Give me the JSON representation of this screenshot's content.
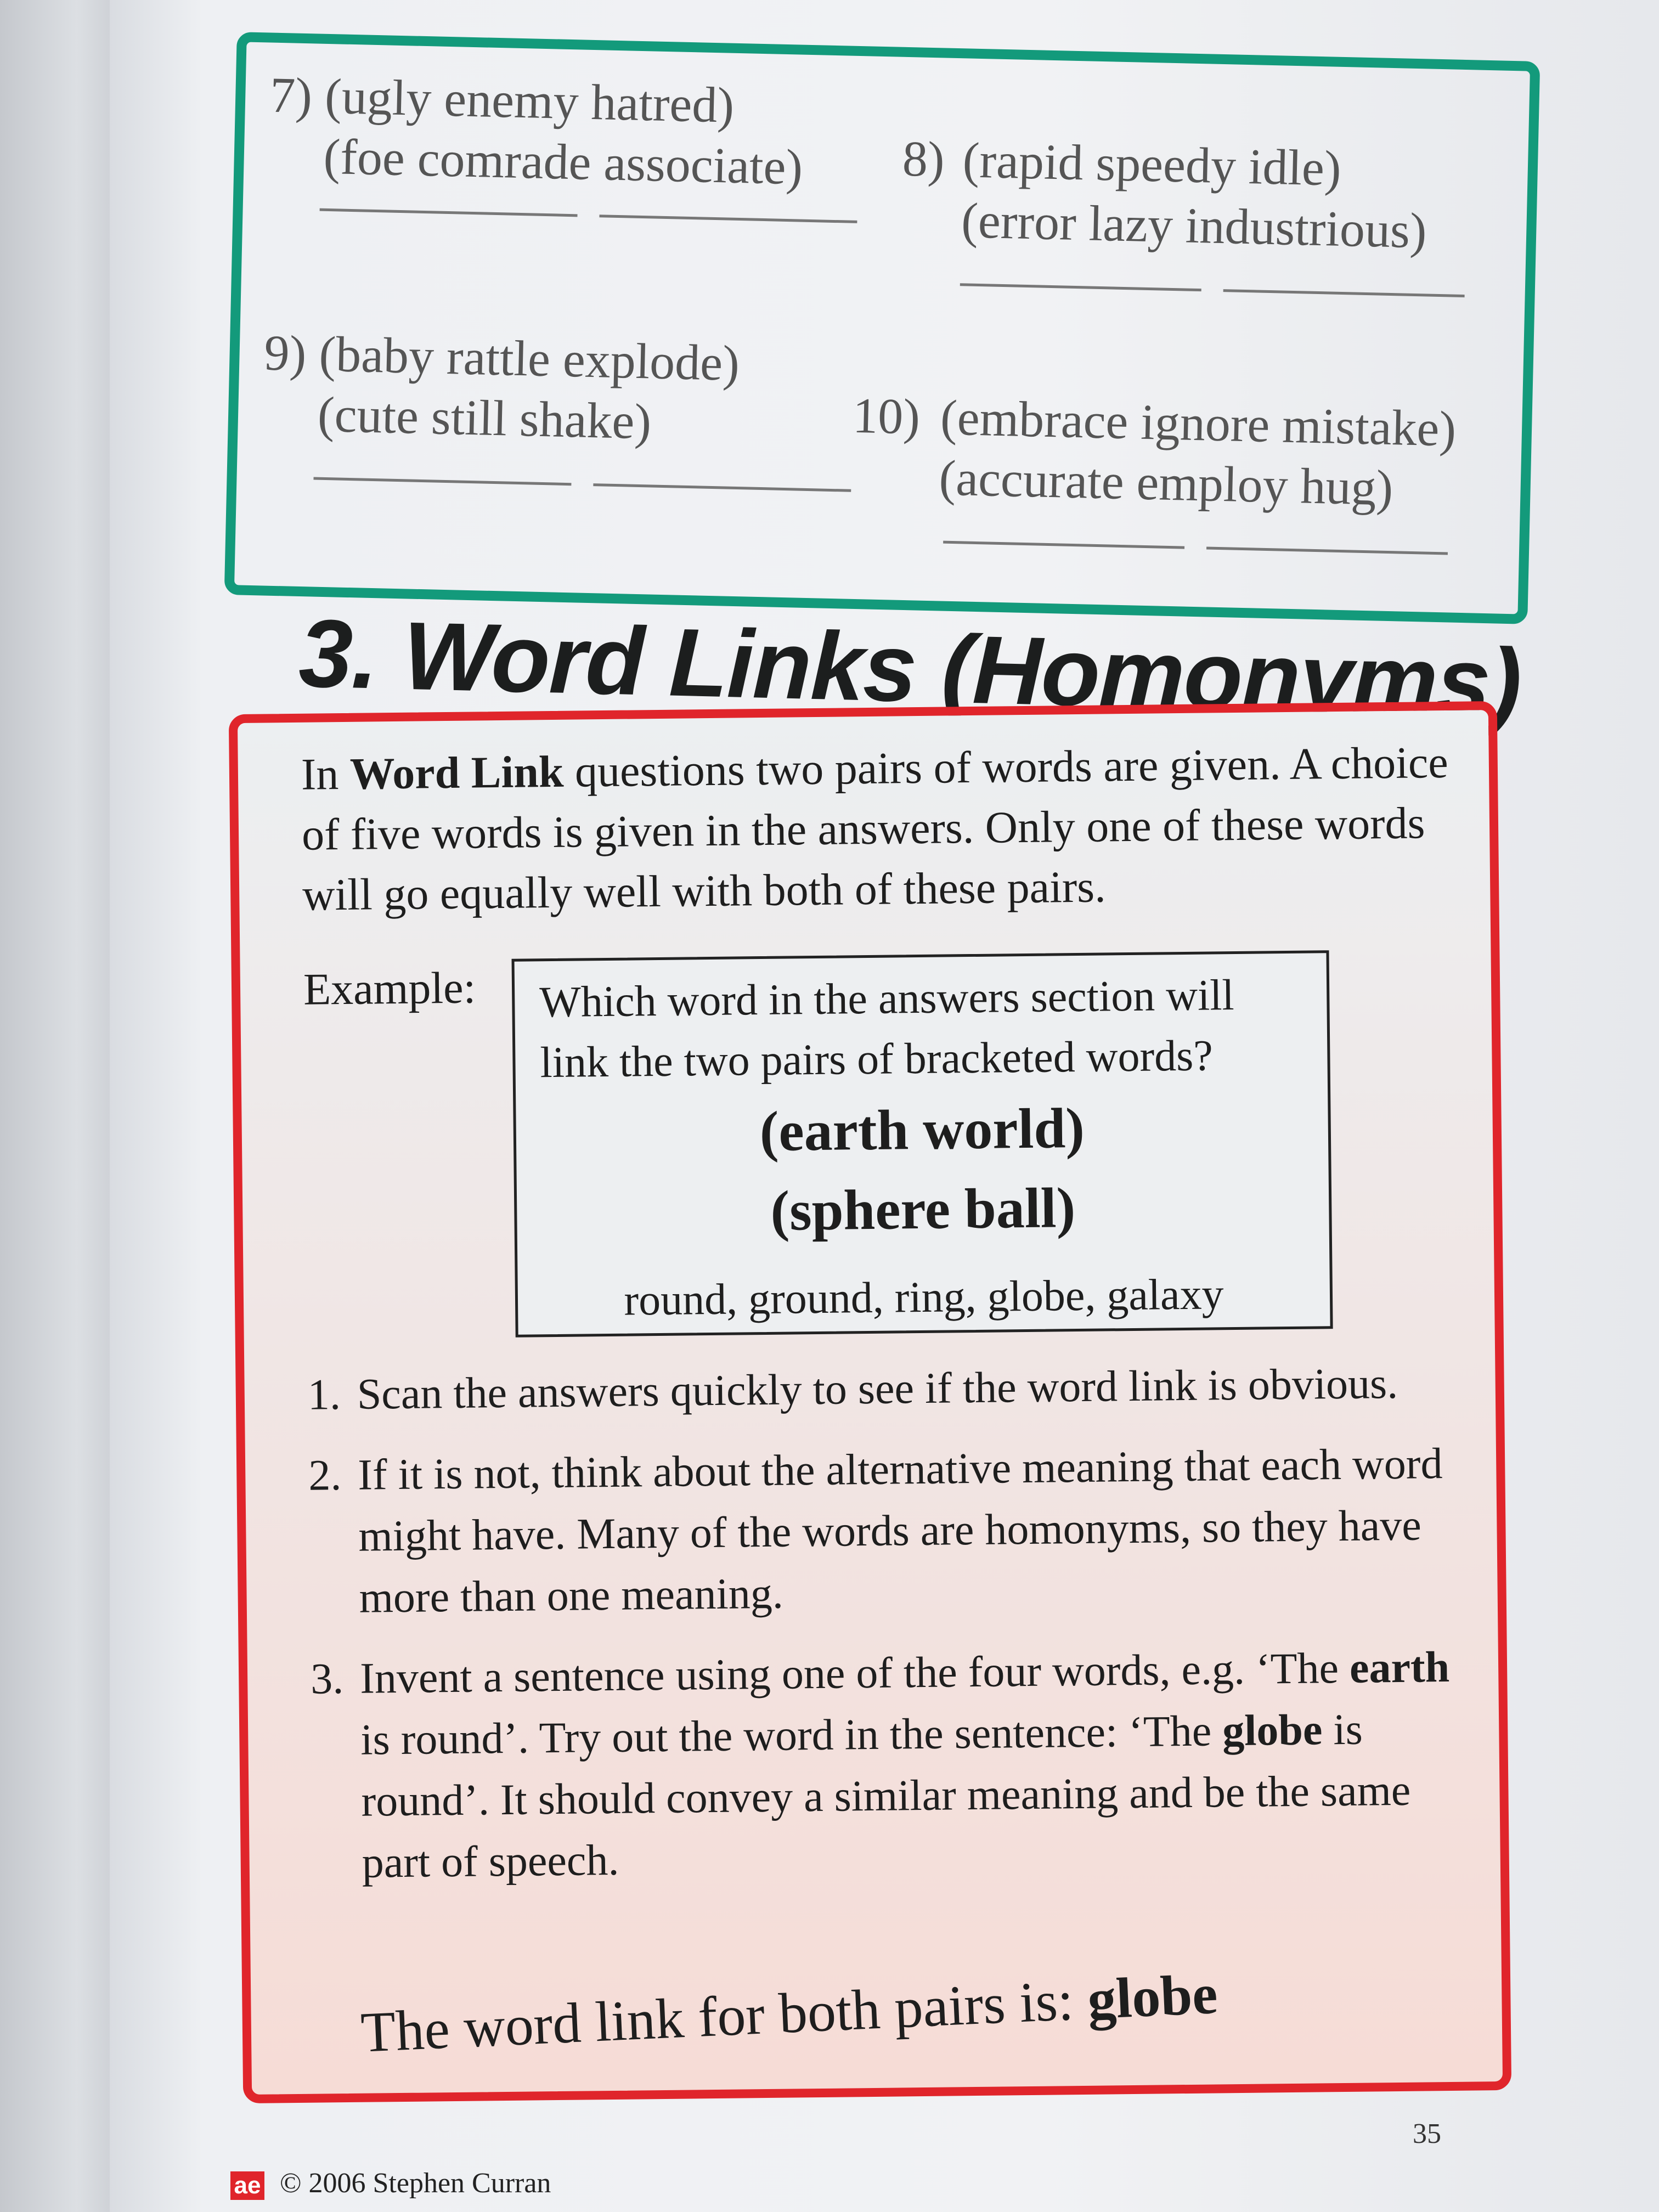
{
  "exercise": {
    "questions": [
      {
        "number": "7)",
        "line1": "(ugly   enemy   hatred)",
        "line2": "(foe   comrade   associate)"
      },
      {
        "number": "8)",
        "line1": "(rapid   speedy   idle)",
        "line2": "(error   lazy   industrious)"
      },
      {
        "number": "9)",
        "line1": "(baby   rattle   explode)",
        "line2": "(cute   still   shake)"
      },
      {
        "number": "10)",
        "line1": "(embrace   ignore   mistake)",
        "line2": "(accurate   employ   hug)"
      }
    ]
  },
  "section": {
    "title": "3. Word Links (Homonyms)"
  },
  "intro": {
    "pre": "In ",
    "bold": "Word Link",
    "post": " questions two pairs of words are given. A choice of five words is given in the answers. Only one of these words will go equally well with both of these pairs."
  },
  "example": {
    "label": "Example:",
    "question": "Which word in the answers section will link the two pairs of bracketed words?",
    "pair1": "(earth    world)",
    "pair2": "(sphere    ball)",
    "answers": "round,  ground,  ring,  globe,  galaxy"
  },
  "steps": [
    {
      "num": "1.",
      "text": "Scan the answers quickly to see if the word link is obvious."
    },
    {
      "num": "2.",
      "text": "If it is not, think about the alternative meaning that each word might have. Many of the words are homonyms, so they have more than one meaning."
    }
  ],
  "step3": {
    "num": "3.",
    "t1": "Invent a sentence using one of the four words, e.g. ‘The ",
    "b1": "earth",
    "t2": " is round’. Try out the word in the sentence: ‘The ",
    "b2": "globe",
    "t3": " is round’. It should convey a similar meaning and be the same part of speech."
  },
  "conclusion": {
    "text": "The word link for both pairs is: ",
    "answer": "globe"
  },
  "footer": {
    "logo": "ae",
    "copyright": "© 2006  Stephen Curran",
    "page_number": "35"
  }
}
